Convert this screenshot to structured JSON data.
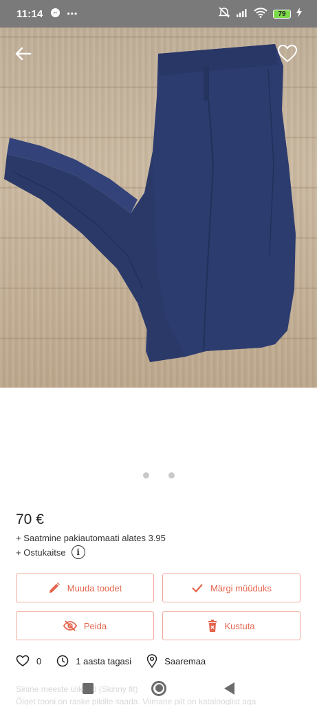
{
  "status_bar": {
    "time": "11:14",
    "battery": "79",
    "icons": [
      "messenger-icon",
      "more-dots-icon",
      "muted-icon",
      "signal-icon",
      "wifi-icon",
      "battery-icon",
      "charging-icon"
    ]
  },
  "product": {
    "image_count": 2,
    "active_image": 1,
    "price": "70 €",
    "shipping": "+ Saatmine pakiautomaati alates 3.95",
    "buyer_protection": "+ Ostukaitse",
    "description_line1": "Sinine meeste ülikond (Skinny fit)",
    "description_line2": "Õiget tooni on raske pildile saada. Viimane pilt on katalooglist aga"
  },
  "actions": {
    "edit": "Muuda toodet",
    "mark_sold": "Märgi müüduks",
    "hide": "Peida",
    "delete": "Kustuta"
  },
  "meta": {
    "likes": "0",
    "posted": "1 aasta tagasi",
    "location": "Saaremaa"
  },
  "colors": {
    "accent": "#e5654d",
    "accent_border": "#f0a99b",
    "status_bar": "#7a7a7a",
    "trousers": "#2c3b6e"
  }
}
